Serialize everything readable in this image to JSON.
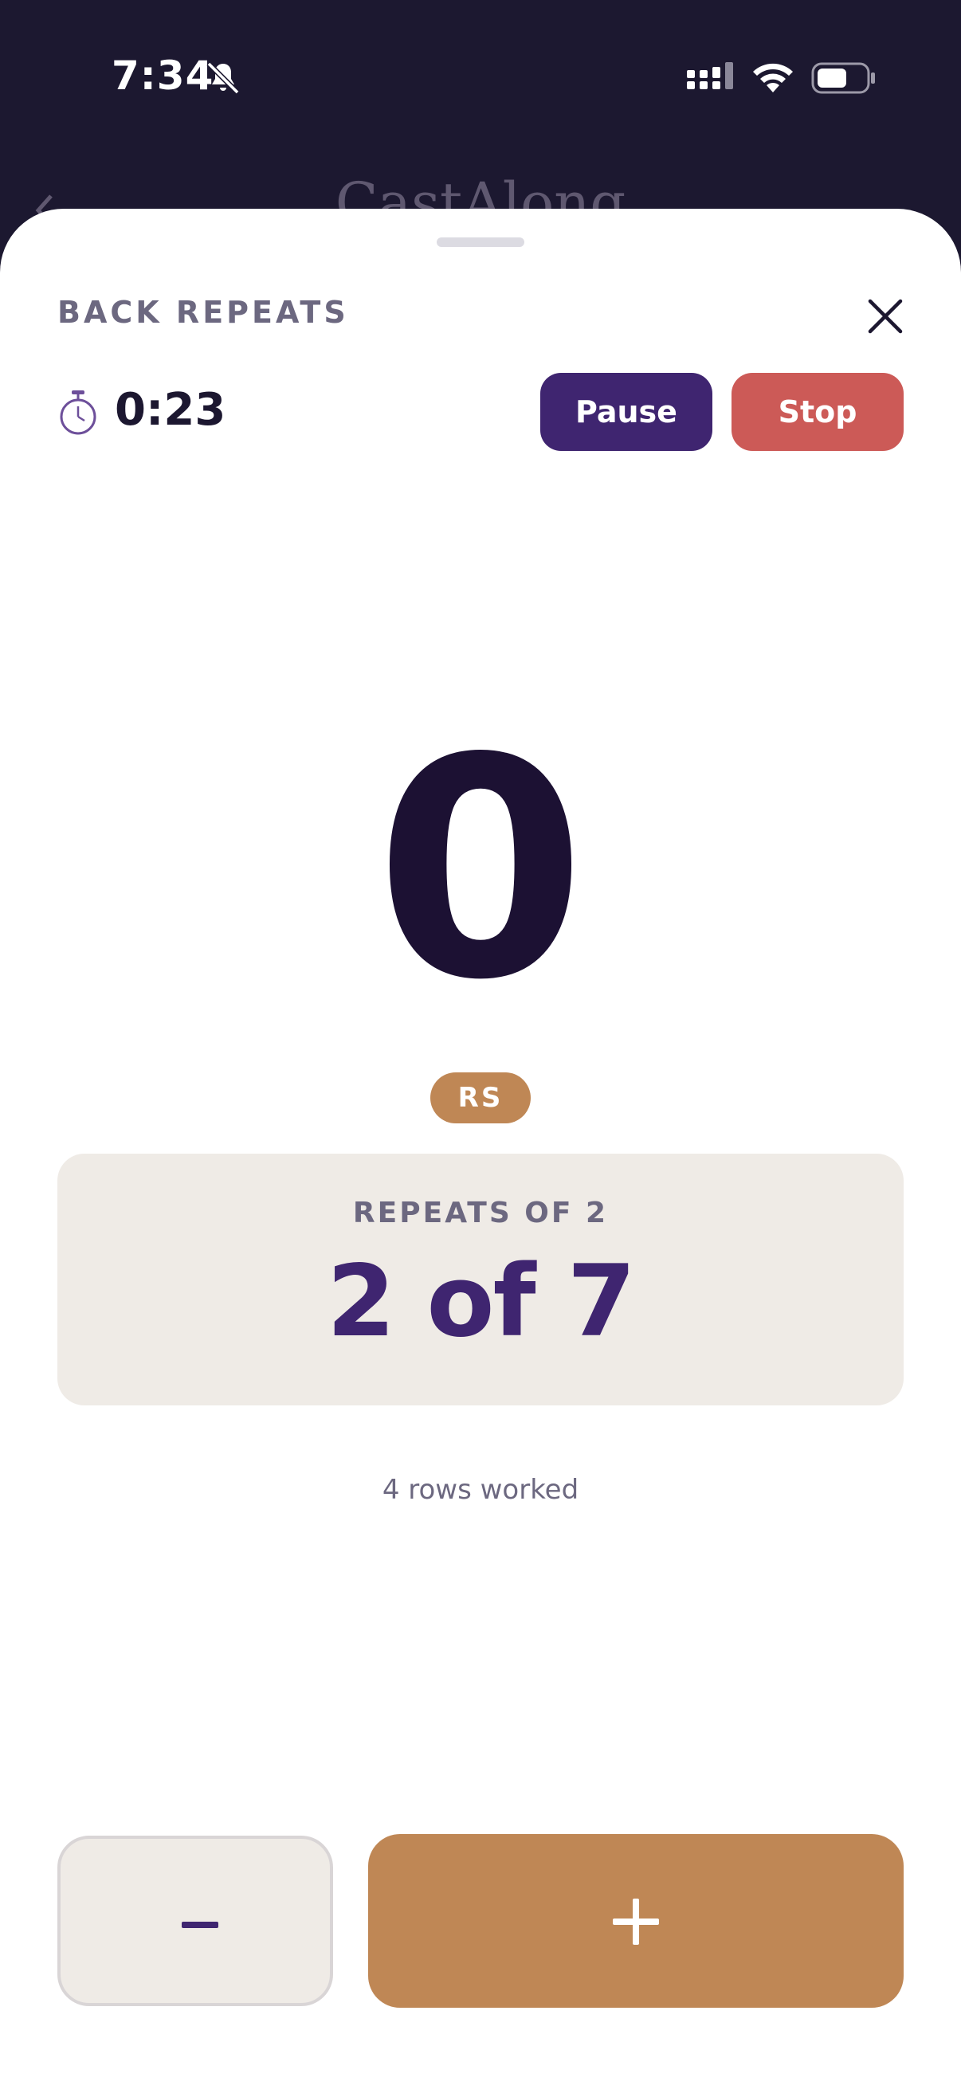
{
  "status_bar": {
    "time": "7:34",
    "icons": [
      "bell-slash-icon",
      "cellular-signal-icon",
      "wifi-icon",
      "battery-icon"
    ]
  },
  "background_header": {
    "title": "CastAlong",
    "back_icon": "chevron-left-icon"
  },
  "sheet": {
    "title": "BACK REPEATS",
    "close_icon": "close-icon",
    "timer": {
      "icon": "stopwatch-icon",
      "value": "0:23"
    },
    "pause_label": "Pause",
    "stop_label": "Stop",
    "count": "0",
    "badge": "RS",
    "repeats": {
      "label": "REPEATS OF 2",
      "progress": "2 of 7"
    },
    "rows_worked": "4 rows worked",
    "decrement_icon": "minus-icon",
    "increment_icon": "plus-icon"
  },
  "colors": {
    "header_bg": "#1c1830",
    "primary_purple": "#3f2570",
    "stop_red": "#cc5a57",
    "accent_tan": "#bf8755",
    "card_bg": "#efebe6",
    "muted_text": "#6c6880"
  }
}
